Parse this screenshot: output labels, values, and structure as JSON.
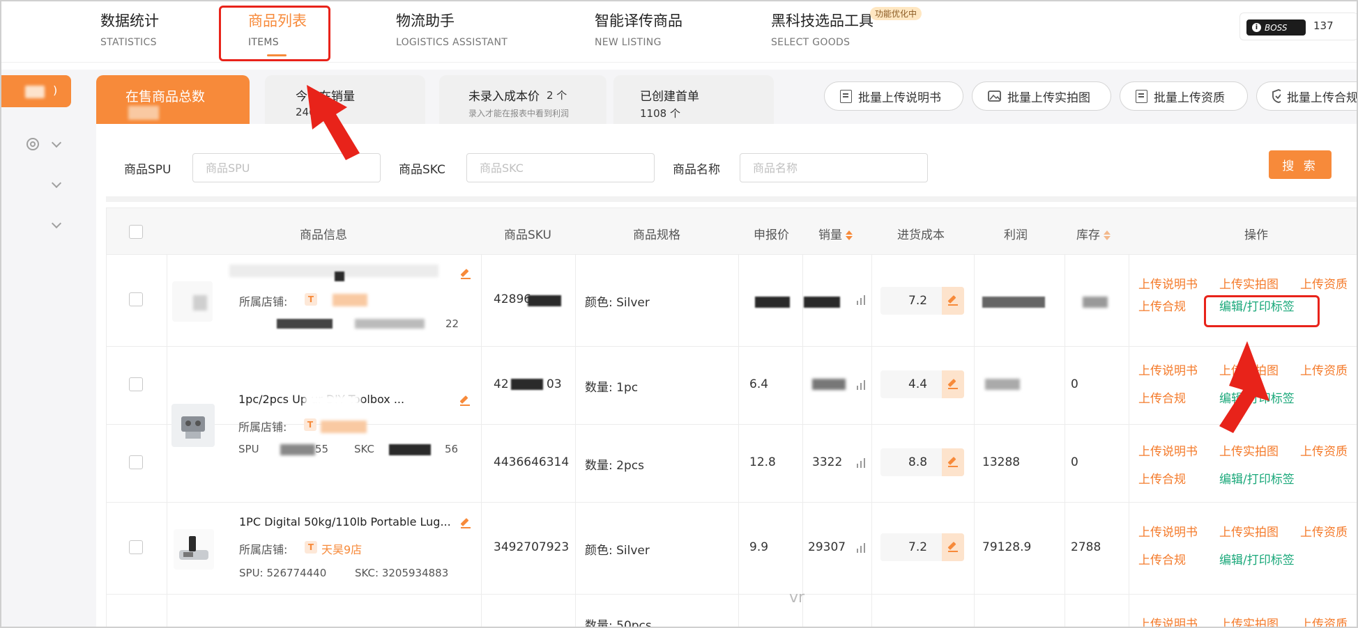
{
  "nav": {
    "items": [
      {
        "cn": "数据统计",
        "en": "STATISTICS"
      },
      {
        "cn": "商品列表",
        "en": "ITEMS"
      },
      {
        "cn": "物流助手",
        "en": "LOGISTICS ASSISTANT"
      },
      {
        "cn": "智能译传商品",
        "en": "NEW LISTING"
      },
      {
        "cn": "黑科技选品工具",
        "en": "SELECT GOODS"
      }
    ],
    "badge": "功能优化中",
    "boss_label": "BOSS",
    "boss_number": "137"
  },
  "sidebar": {
    "pill_text": ")"
  },
  "stats": {
    "tabs": [
      {
        "title": "在售商品总数",
        "value": ""
      },
      {
        "title": "今日在销量",
        "value": "240"
      },
      {
        "title": "未录入成本价",
        "count": "2 个",
        "sub": "录入才能在报表中看到利润"
      },
      {
        "title": "已创建首单",
        "value": "1108 个"
      }
    ]
  },
  "bulk_buttons": [
    {
      "label": "批量上传说明书",
      "icon": "document-icon"
    },
    {
      "label": "批量上传实拍图",
      "icon": "image-upload-icon"
    },
    {
      "label": "批量上传资质",
      "icon": "certificate-icon"
    },
    {
      "label": "批量上传合规",
      "icon": "shield-check-icon"
    }
  ],
  "search": {
    "spu_label": "商品SPU",
    "spu_placeholder": "商品SPU",
    "skc_label": "商品SKC",
    "skc_placeholder": "商品SKC",
    "name_label": "商品名称",
    "name_placeholder": "商品名称",
    "button": "搜 索"
  },
  "table": {
    "headers": {
      "info": "商品信息",
      "sku": "商品SKU",
      "spec": "商品规格",
      "price": "申报价",
      "sales": "销量",
      "cost": "进货成本",
      "profit": "利润",
      "stock": "库存",
      "ops": "操作"
    },
    "shop_label": "所属店铺:",
    "ops": {
      "manual": "上传说明书",
      "photo": "上传实拍图",
      "qualification": "上传资质",
      "compliance": "上传合规",
      "label": "编辑/打印标签"
    },
    "rows": [
      {
        "name": "",
        "sku": "42896",
        "spec": "颜色: Silver",
        "price": "",
        "sales": "",
        "cost": "7.2",
        "profit": "",
        "stock": "",
        "spu_suffix": "",
        "skc_suffix": "22"
      },
      {
        "name": "1pc/2pcs Up        ur DIY Toolbox ...",
        "sku": "42",
        "sku_suffix": "03",
        "spec": "数量: 1pc",
        "price": "6.4",
        "sales": "",
        "cost": "4.4",
        "profit": "",
        "stock": "0"
      },
      {
        "sku": "4436646314",
        "spec": "数量: 2pcs",
        "price": "12.8",
        "sales": "3322",
        "cost": "8.8",
        "profit": "13288",
        "stock": "0",
        "spu": "SPU",
        "spu_suffix": "55",
        "skc": "SKC",
        "skc_suffix": "56"
      },
      {
        "name": "1PC Digital 50kg/110lb Portable Lug...",
        "shop": "天昊9店",
        "sku": "3492707923",
        "spec": "颜色: Silver",
        "price": "9.9",
        "sales": "29307",
        "cost": "7.2",
        "profit": "79128.9",
        "stock": "2788",
        "spu": "SPU:  526774440",
        "skc": "SKC:  3205934883"
      },
      {
        "spec": "数量: 50pcs"
      }
    ]
  },
  "watermark": "vr",
  "colors": {
    "accent": "#f78a3a",
    "op_orange": "#f47a2a",
    "op_green": "#1aa87a",
    "annotation_red": "#e8231a"
  }
}
